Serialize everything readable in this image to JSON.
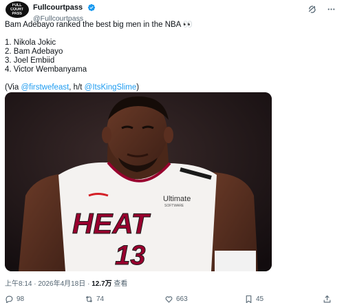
{
  "author": {
    "avatar_text_1": "FULL",
    "avatar_text_2": "COURT",
    "avatar_text_3": "PASS",
    "display_name": "Fullcourtpass",
    "handle": "@Fullcourtpass"
  },
  "tweet": {
    "line1": "Bam Adebayo ranked the best big men in the NBA 👀",
    "list": [
      "1. Nikola Jokic",
      "2. Bam Adebayo",
      "3. Joel Embiid",
      "4. Victor Wembanyama"
    ],
    "via_prefix": "(Via ",
    "via_link1": "@firstwefeast",
    "via_mid": ", h/t ",
    "via_link2": "@ItsKingSlime",
    "via_suffix": ")"
  },
  "media": {
    "jersey_text": "HEAT",
    "jersey_number": "13",
    "sponsor": "Ultimate",
    "sponsor_sub": "SOFTWARE"
  },
  "meta": {
    "time": "上午8:14",
    "sep1": " · ",
    "date": "2026年4月18日",
    "sep2": " · ",
    "views": "12.7万",
    "views_label": " 查看"
  },
  "actions": {
    "replies": "98",
    "reposts": "74",
    "likes": "663",
    "bookmarks": "45"
  },
  "colors": {
    "link": "#1d9bf0",
    "verified": "#1d9bf0",
    "heat_red": "#98002e"
  }
}
